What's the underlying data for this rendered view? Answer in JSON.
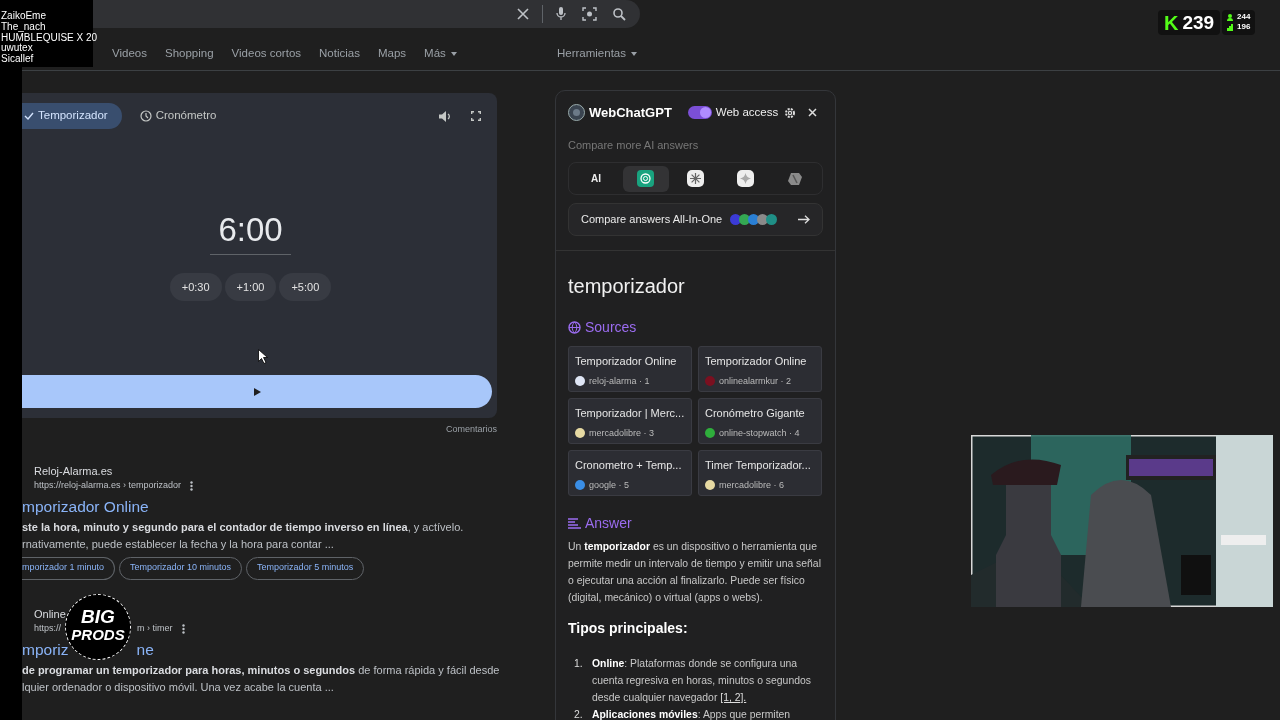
{
  "chat_names": [
    "ZaikoEme",
    "The_nach",
    "HUMBLEQUISE X 20",
    "uwutex",
    "Sicallef"
  ],
  "kick_badge": {
    "logo": "K",
    "count": "239"
  },
  "viewer_stats": [
    "244",
    "196"
  ],
  "search_tabs": [
    {
      "label": "Videos",
      "menu": false
    },
    {
      "label": "Shopping",
      "menu": false
    },
    {
      "label": "Videos cortos",
      "menu": false
    },
    {
      "label": "Noticias",
      "menu": false
    },
    {
      "label": "Maps",
      "menu": false
    },
    {
      "label": "Más",
      "menu": true
    }
  ],
  "tools": {
    "label": "Herramientas",
    "menu": true
  },
  "timer": {
    "tabs": [
      {
        "label": "Temporizador",
        "selected": true
      },
      {
        "label": "Cronómetro",
        "selected": false
      }
    ],
    "time": "6:00",
    "add_buttons": [
      "+0:30",
      "+1:00",
      "+5:00"
    ],
    "feedback": "Comentarios"
  },
  "results": [
    {
      "site": "Reloj-Alarma.es",
      "url_parts": [
        "https://reloj-alarma.es › temporizador"
      ],
      "title_parts": [
        "mporizador Online"
      ],
      "snippet_lines": [
        "**ste la hora, minuto y segundo para el contador de tiempo inverso en línea**, y actívelo.",
        "rnativamente, puede establecer la fecha y la hora para contar ..."
      ],
      "chips": [
        "mporizador 1 minuto",
        "Temporizador 10 minutos",
        "Temporizador 5 minutos"
      ]
    },
    {
      "site": "Online",
      "url_parts": [
        "https://",
        "m › timer"
      ],
      "title_parts": [
        "mporiz",
        "ne"
      ],
      "snippet_lines": [
        "**de programar un temporizador para horas, minutos o segundos** de forma rápida y fácil desde",
        "lquier ordenador o dispositivo móvil. Una vez acabe la cuenta ..."
      ]
    }
  ],
  "overlay_logo": {
    "lines": [
      "BIG",
      "PRODS"
    ]
  },
  "webchatgpt": {
    "title": "WebChatGPT",
    "web_access": {
      "label": "Web access",
      "on": true
    },
    "compare_hint": "Compare more AI answers",
    "ai_models": [
      {
        "kind": "text",
        "label": "AI",
        "selected": false
      },
      {
        "kind": "knot",
        "selected": true
      },
      {
        "kind": "burst",
        "selected": false
      },
      {
        "kind": "sparkle",
        "selected": false
      },
      {
        "kind": "blob",
        "selected": false
      }
    ],
    "compare_all": {
      "label": "Compare answers All-In-One",
      "icons": [
        {
          "color": "#3b3bd6"
        },
        {
          "color": "#34a853"
        },
        {
          "color": "#2a7fd4"
        },
        {
          "color": "#8a8a8a"
        },
        {
          "color": "#1f8f86"
        }
      ]
    },
    "query": "temporizador",
    "sources_title": "Sources",
    "sources": [
      {
        "title": "Temporizador Online",
        "meta": "reloj-alarma · 1",
        "color": "#dfe6f5"
      },
      {
        "title": "Temporizador Online",
        "meta": "onlinealarmkur · 2",
        "color": "#7a1020"
      },
      {
        "title": "Temporizador | Merc...",
        "meta": "mercadolibre · 3",
        "color": "#e6d9a2"
      },
      {
        "title": "Cronómetro Gigante",
        "meta": "online-stopwatch · 4",
        "color": "#2fae3c"
      },
      {
        "title": "Cronometro + Temp...",
        "meta": "google · 5",
        "color": "#3a8ee6"
      },
      {
        "title": "Timer Temporizador...",
        "meta": "mercadolibre · 6",
        "color": "#e6d9a2"
      }
    ],
    "answer_title": "Answer",
    "answer": "Un **temporizador** es un dispositivo o herramienta que permite medir un intervalo de tiempo y emitir una señal o ejecutar una acción al finalizarlo. Puede ser físico (digital, mecánico) o virtual (apps o webs).",
    "subheading": "Tipos principales:",
    "types": [
      {
        "marker": "1.",
        "text": "**Online**: Plataformas donde se configura una cuenta regresiva en horas, minutos o segundos desde cualquier navegador",
        "citation": "[1, 2]."
      },
      {
        "marker": "2.",
        "text": "**Aplicaciones móviles**: Apps que permiten"
      }
    ]
  }
}
